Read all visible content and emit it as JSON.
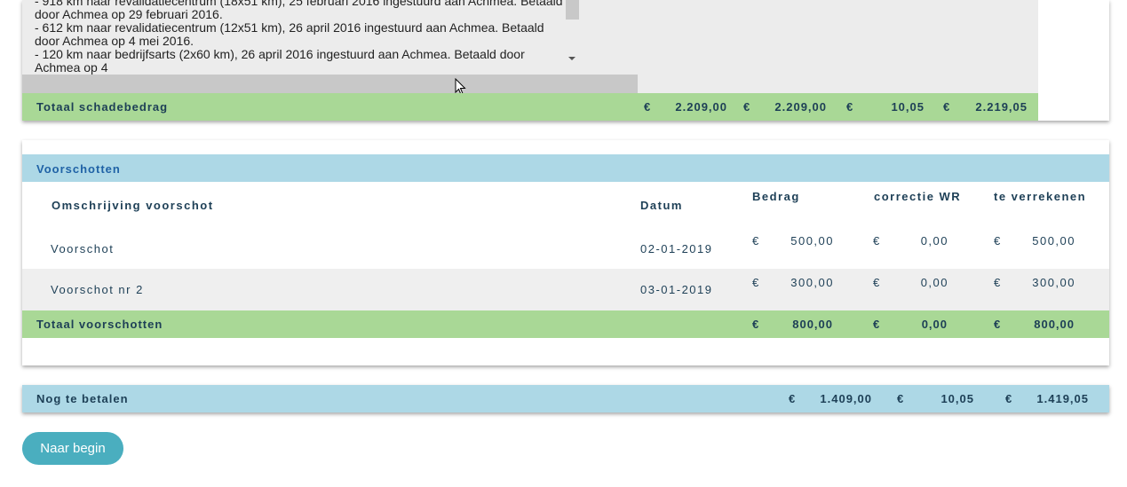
{
  "schade": {
    "notes_lines": [
      "- 918 km naar revalidatiecentrum (18x51 km), 25 februari 2016 ingestuurd aan Achmea. Betaald door Achmea op 29 februari 2016.",
      "- 612 km naar revalidatiecentrum (12x51 km), 26 april 2016 ingestuurd aan Achmea. Betaald door Achmea op 4 mei 2016.",
      "- 120 km naar bedrijfsarts (2x60 km), 26 april 2016 ingestuurd aan Achmea. Betaald door Achmea op 4"
    ],
    "total_label": "Totaal schadebedrag",
    "total": {
      "euro": "€",
      "bedrag": "2.209,00",
      "bedrag2": "2.209,00",
      "correctie": "10,05",
      "totaal": "2.219,05"
    }
  },
  "voorschotten": {
    "title": "Voorschotten",
    "headers": {
      "omschrijving": "Omschrijving voorschot",
      "datum": "Datum",
      "bedrag": "Bedrag",
      "correctie": "correctie WR",
      "verrekenen": "te verrekenen"
    },
    "rows": [
      {
        "omschrijving": "Voorschot",
        "datum": "02-01-2019",
        "euro": "€",
        "bedrag": "500,00",
        "correctie": "0,00",
        "verrekenen": "500,00"
      },
      {
        "omschrijving": "Voorschot nr 2",
        "datum": "03-01-2019",
        "euro": "€",
        "bedrag": "300,00",
        "correctie": "0,00",
        "verrekenen": "300,00"
      }
    ],
    "total_label": "Totaal voorschotten",
    "total": {
      "euro": "€",
      "bedrag": "800,00",
      "correctie": "0,00",
      "verrekenen": "800,00"
    }
  },
  "nog_te_betalen": {
    "label": "Nog te betalen",
    "euro": "€",
    "bedrag": "1.409,00",
    "correctie": "10,05",
    "totaal": "1.419,05"
  },
  "buttons": {
    "naar_begin": "Naar begin"
  },
  "colors": {
    "total_green": "#a9d896",
    "header_blue": "#add8e6",
    "button_teal": "#4aaebf",
    "text_navy": "#1d3f56"
  }
}
